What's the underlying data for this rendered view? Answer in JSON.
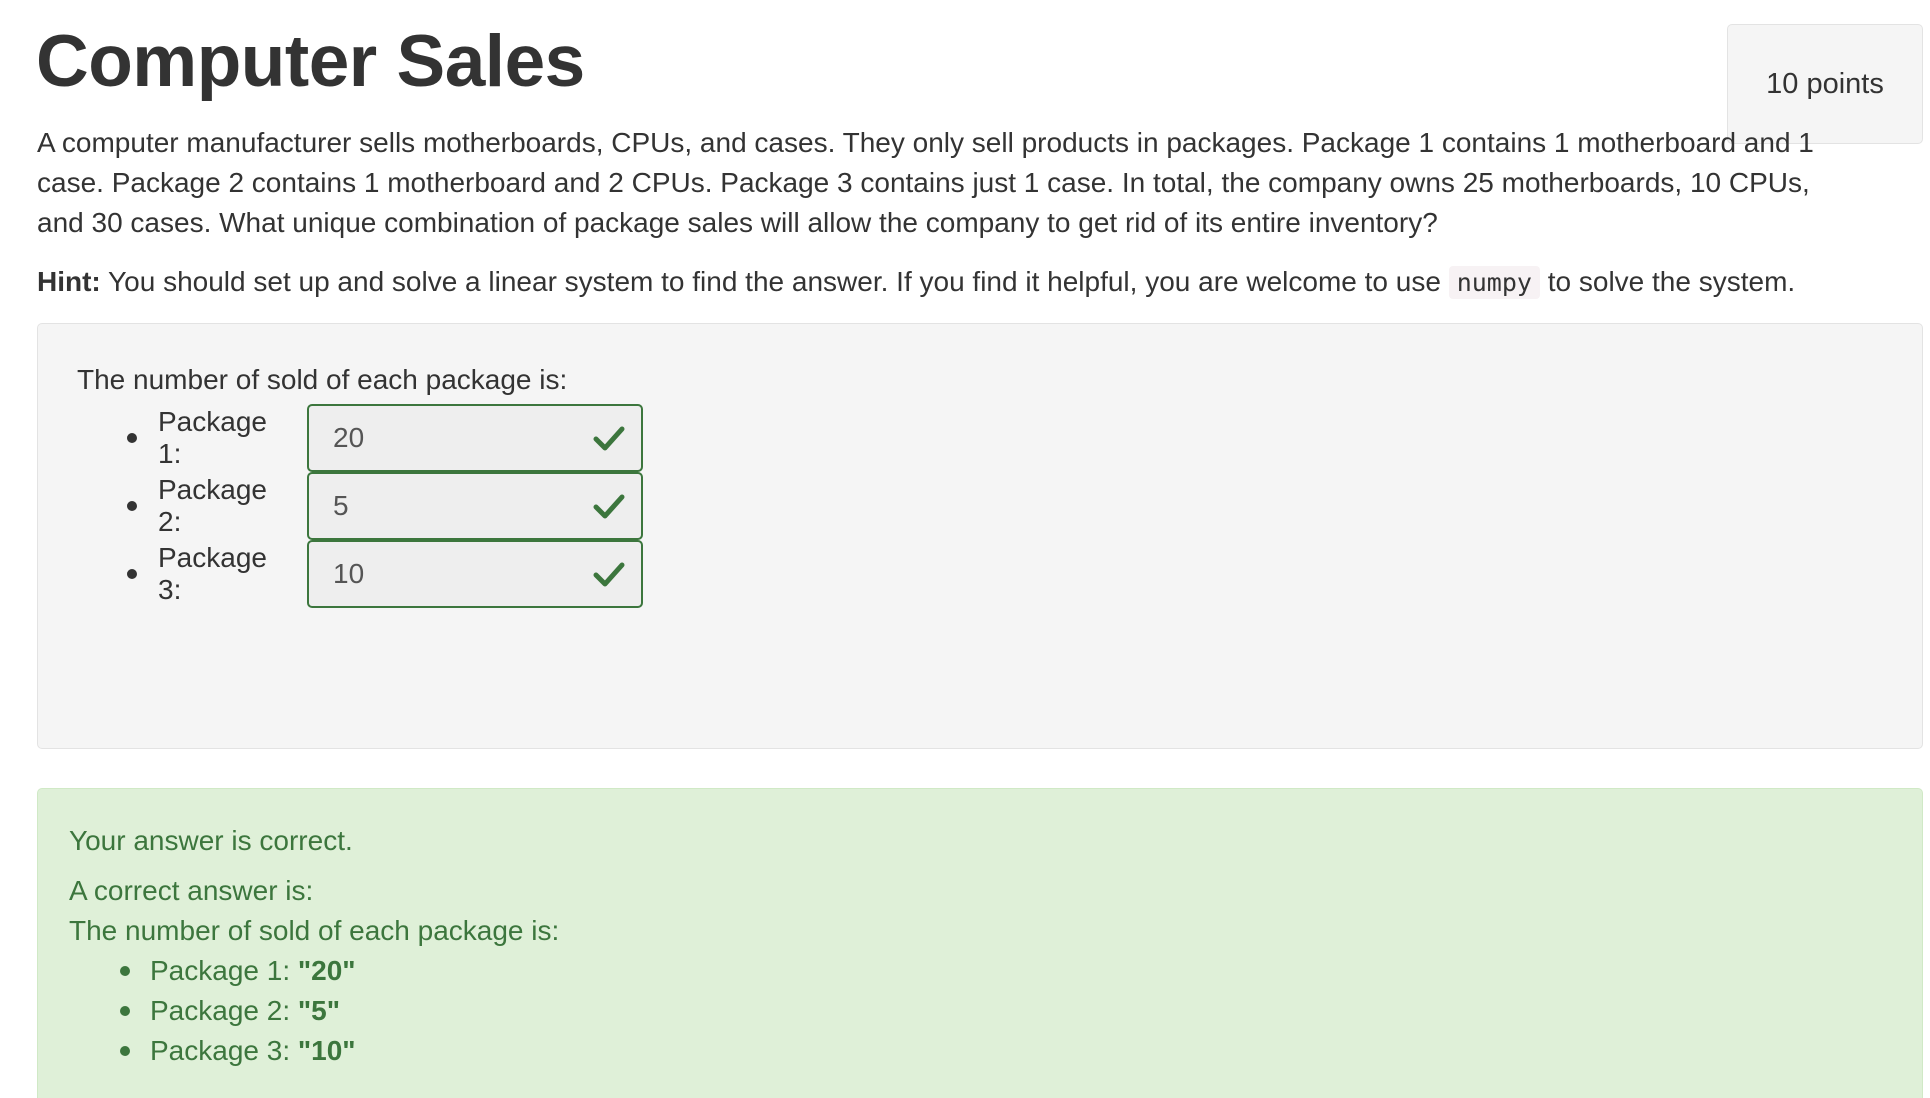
{
  "header": {
    "title": "Computer Sales",
    "points": "10 points"
  },
  "problem": {
    "text": "A computer manufacturer sells motherboards, CPUs, and cases. They only sell products in packages. Package 1 contains 1 motherboard and 1 case. Package 2 contains 1 motherboard and 2 CPUs. Package 3 contains just 1 case. In total, the company owns 25 motherboards, 10 CPUs, and 30 cases. What unique combination of package sales will allow the company to get rid of its entire inventory?",
    "hint_label": "Hint:",
    "hint_before": "You should set up and solve a linear system to find the answer. If you find it helpful, you are welcome to use",
    "hint_code": "numpy",
    "hint_after": "to solve the system."
  },
  "question": {
    "lead": "The number of sold of each package is:",
    "items": [
      {
        "label": "Package 1:",
        "value": "20",
        "status_icon": "check-icon"
      },
      {
        "label": "Package 2:",
        "value": "5",
        "status_icon": "check-icon"
      },
      {
        "label": "Package 3:",
        "value": "10",
        "status_icon": "check-icon"
      }
    ]
  },
  "feedback": {
    "status": "Your answer is correct.",
    "correct_intro": "A correct answer is:",
    "lead": "The number of sold of each package is:",
    "items": [
      {
        "label": "Package 1:",
        "value": "\"20\""
      },
      {
        "label": "Package 2:",
        "value": "\"5\""
      },
      {
        "label": "Package 3:",
        "value": "\"10\""
      }
    ]
  },
  "colors": {
    "success": "#3c763d",
    "success_bg": "#dff0d8",
    "panel_bg": "#f5f5f5",
    "text": "#333333"
  }
}
